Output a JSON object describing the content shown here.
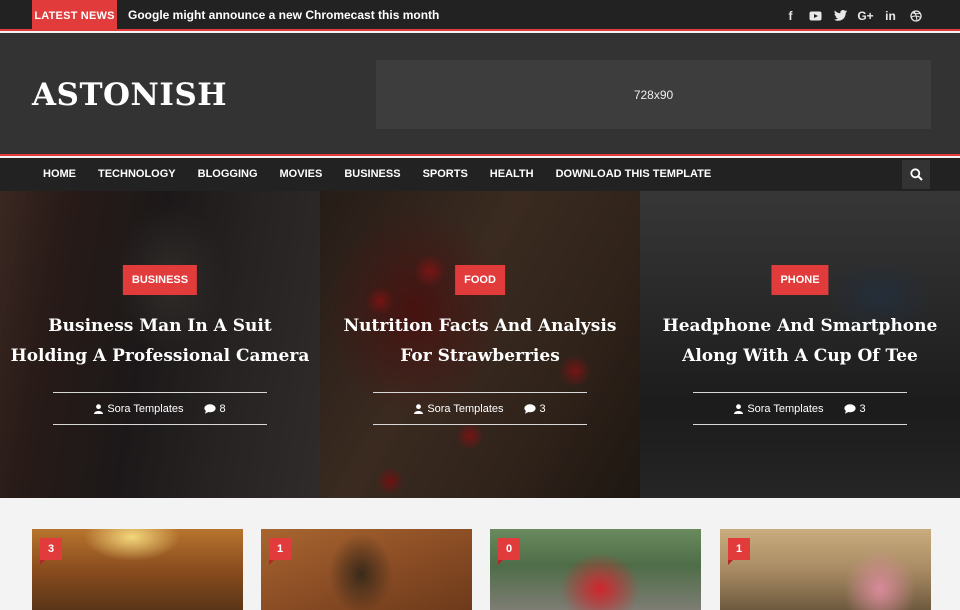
{
  "topbar": {
    "label": "LATEST NEWS",
    "headline": "Google might announce a new Chromecast this month",
    "social": [
      {
        "icon": "facebook-icon",
        "glyph": "f"
      },
      {
        "icon": "youtube-icon",
        "glyph": "▶"
      },
      {
        "icon": "twitter-icon",
        "glyph": "t"
      },
      {
        "icon": "google-plus-icon",
        "glyph": "G+"
      },
      {
        "icon": "linkedin-icon",
        "glyph": "in"
      },
      {
        "icon": "dribbble-icon",
        "glyph": "◎"
      }
    ]
  },
  "header": {
    "logo": "ASTONISH",
    "ad_text": "728x90"
  },
  "nav": {
    "items": [
      "HOME",
      "TECHNOLOGY",
      "BLOGGING",
      "MOVIES",
      "BUSINESS",
      "SPORTS",
      "HEALTH",
      "DOWNLOAD THIS TEMPLATE"
    ]
  },
  "featured": [
    {
      "category": "BUSINESS",
      "title": "Business Man In A Suit Holding A Professional Camera",
      "author": "Sora Templates",
      "comments": "8"
    },
    {
      "category": "FOOD",
      "title": "Nutrition Facts And Analysis For Strawberries",
      "author": "Sora Templates",
      "comments": "3"
    },
    {
      "category": "PHONE",
      "title": "Headphone And Smartphone Along With A Cup Of Tee",
      "author": "Sora Templates",
      "comments": "3"
    }
  ],
  "cards": [
    {
      "count": "3"
    },
    {
      "count": "1"
    },
    {
      "count": "0"
    },
    {
      "count": "1"
    }
  ],
  "colors": {
    "accent": "#e23b3b",
    "topbar_bg": "#222222",
    "header_bg": "#333333",
    "page_bg": "#f3f3f3"
  }
}
